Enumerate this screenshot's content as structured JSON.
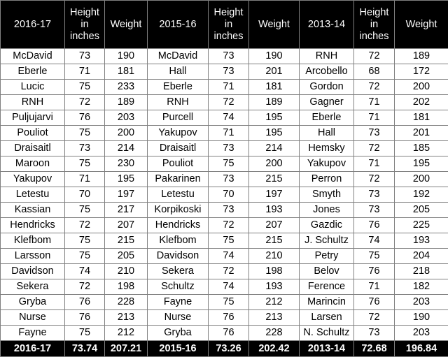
{
  "table": {
    "columns": [
      {
        "key": "name_2016",
        "label": "2016-17",
        "group": "2016-17",
        "type": "name"
      },
      {
        "key": "h_2016",
        "label": "Height in inches",
        "group": "2016-17",
        "type": "height"
      },
      {
        "key": "w_2016",
        "label": "Weight",
        "group": "2016-17",
        "type": "weight"
      },
      {
        "key": "name_2015",
        "label": "2015-16",
        "group": "2015-16",
        "type": "name"
      },
      {
        "key": "h_2015",
        "label": "Height in inches",
        "group": "2015-16",
        "type": "height"
      },
      {
        "key": "w_2015",
        "label": "Weight",
        "group": "2015-16",
        "type": "weight"
      },
      {
        "key": "name_2013",
        "label": "2013-14",
        "group": "2013-14",
        "type": "name"
      },
      {
        "key": "h_2013",
        "label": "Height in inches",
        "group": "2013-14",
        "type": "height"
      },
      {
        "key": "w_2013",
        "label": "Weight",
        "group": "2013-14",
        "type": "weight"
      }
    ],
    "header_lines": {
      "height": [
        "Height",
        "in",
        "inches"
      ]
    },
    "rows": [
      [
        "McDavid",
        "73",
        "190",
        "McDavid",
        "73",
        "190",
        "RNH",
        "72",
        "189"
      ],
      [
        "Eberle",
        "71",
        "181",
        "Hall",
        "73",
        "201",
        "Arcobello",
        "68",
        "172"
      ],
      [
        "Lucic",
        "75",
        "233",
        "Eberle",
        "71",
        "181",
        "Gordon",
        "72",
        "200"
      ],
      [
        "RNH",
        "72",
        "189",
        "RNH",
        "72",
        "189",
        "Gagner",
        "71",
        "202"
      ],
      [
        "Puljujarvi",
        "76",
        "203",
        "Purcell",
        "74",
        "195",
        "Eberle",
        "71",
        "181"
      ],
      [
        "Pouliot",
        "75",
        "200",
        "Yakupov",
        "71",
        "195",
        "Hall",
        "73",
        "201"
      ],
      [
        "Draisaitl",
        "73",
        "214",
        "Draisaitl",
        "73",
        "214",
        "Hemsky",
        "72",
        "185"
      ],
      [
        "Maroon",
        "75",
        "230",
        "Pouliot",
        "75",
        "200",
        "Yakupov",
        "71",
        "195"
      ],
      [
        "Yakupov",
        "71",
        "195",
        "Pakarinen",
        "73",
        "215",
        "Perron",
        "72",
        "200"
      ],
      [
        "Letestu",
        "70",
        "197",
        "Letestu",
        "70",
        "197",
        "Smyth",
        "73",
        "192"
      ],
      [
        "Kassian",
        "75",
        "217",
        "Korpikoski",
        "73",
        "193",
        "Jones",
        "73",
        "205"
      ],
      [
        "Hendricks",
        "72",
        "207",
        "Hendricks",
        "72",
        "207",
        "Gazdic",
        "76",
        "225"
      ],
      [
        "Klefbom",
        "75",
        "215",
        "Klefbom",
        "75",
        "215",
        "J. Schultz",
        "74",
        "193"
      ],
      [
        "Larsson",
        "75",
        "205",
        "Davidson",
        "74",
        "210",
        "Petry",
        "75",
        "204"
      ],
      [
        "Davidson",
        "74",
        "210",
        "Sekera",
        "72",
        "198",
        "Belov",
        "76",
        "218"
      ],
      [
        "Sekera",
        "72",
        "198",
        "Schultz",
        "74",
        "193",
        "Ference",
        "71",
        "182"
      ],
      [
        "Gryba",
        "76",
        "228",
        "Fayne",
        "75",
        "212",
        "Marincin",
        "76",
        "203"
      ],
      [
        "Nurse",
        "76",
        "213",
        "Nurse",
        "76",
        "213",
        "Larsen",
        "72",
        "190"
      ],
      [
        "Fayne",
        "75",
        "212",
        "Gryba",
        "76",
        "228",
        "N. Schultz",
        "73",
        "203"
      ]
    ],
    "totals": [
      "2016-17",
      "73.74",
      "207.21",
      "2015-16",
      "73.26",
      "202.42",
      "2013-14",
      "72.68",
      "196.84"
    ]
  },
  "chart_data": {
    "type": "table",
    "title": "Edmonton Oilers roster height and weight by season",
    "columns": [
      "2016-17",
      "Height in inches",
      "Weight",
      "2015-16",
      "Height in inches",
      "Weight",
      "2013-14",
      "Height in inches",
      "Weight"
    ],
    "series": [
      {
        "name": "2016-17",
        "players": [
          "McDavid",
          "Eberle",
          "Lucic",
          "RNH",
          "Puljujarvi",
          "Pouliot",
          "Draisaitl",
          "Maroon",
          "Yakupov",
          "Letestu",
          "Kassian",
          "Hendricks",
          "Klefbom",
          "Larsson",
          "Davidson",
          "Sekera",
          "Gryba",
          "Nurse",
          "Fayne"
        ],
        "height_in": [
          73,
          71,
          75,
          72,
          76,
          75,
          73,
          75,
          71,
          70,
          75,
          72,
          75,
          75,
          74,
          72,
          76,
          76,
          75
        ],
        "weight_lb": [
          190,
          181,
          233,
          189,
          203,
          200,
          214,
          230,
          195,
          197,
          217,
          207,
          215,
          205,
          210,
          198,
          228,
          213,
          212
        ],
        "avg_height_in": 73.74,
        "avg_weight_lb": 207.21
      },
      {
        "name": "2015-16",
        "players": [
          "McDavid",
          "Hall",
          "Eberle",
          "RNH",
          "Purcell",
          "Yakupov",
          "Draisaitl",
          "Pouliot",
          "Pakarinen",
          "Letestu",
          "Korpikoski",
          "Hendricks",
          "Klefbom",
          "Davidson",
          "Sekera",
          "Schultz",
          "Fayne",
          "Nurse",
          "Gryba"
        ],
        "height_in": [
          73,
          73,
          71,
          72,
          74,
          71,
          73,
          75,
          73,
          70,
          73,
          72,
          75,
          74,
          72,
          74,
          75,
          76,
          76
        ],
        "weight_lb": [
          190,
          201,
          181,
          189,
          195,
          195,
          214,
          200,
          215,
          197,
          193,
          207,
          215,
          210,
          198,
          193,
          212,
          213,
          228
        ],
        "avg_height_in": 73.26,
        "avg_weight_lb": 202.42
      },
      {
        "name": "2013-14",
        "players": [
          "RNH",
          "Arcobello",
          "Gordon",
          "Gagner",
          "Eberle",
          "Hall",
          "Hemsky",
          "Yakupov",
          "Perron",
          "Smyth",
          "Jones",
          "Gazdic",
          "J. Schultz",
          "Petry",
          "Belov",
          "Ference",
          "Marincin",
          "Larsen",
          "N. Schultz"
        ],
        "height_in": [
          72,
          68,
          72,
          71,
          71,
          73,
          72,
          71,
          72,
          73,
          73,
          76,
          74,
          75,
          76,
          71,
          76,
          72,
          73
        ],
        "weight_lb": [
          189,
          172,
          200,
          202,
          181,
          201,
          185,
          195,
          200,
          192,
          205,
          225,
          193,
          204,
          218,
          182,
          203,
          190,
          203
        ],
        "avg_height_in": 72.68,
        "avg_weight_lb": 196.84
      }
    ],
    "grid": true,
    "legend": "none"
  },
  "colors": {
    "header_bg": "#000000",
    "header_fg": "#ffffff",
    "cell_bg": "#ffffff",
    "cell_fg": "#000000",
    "border": "#808080",
    "totals_bg": "#000000",
    "totals_fg": "#ffffff"
  }
}
